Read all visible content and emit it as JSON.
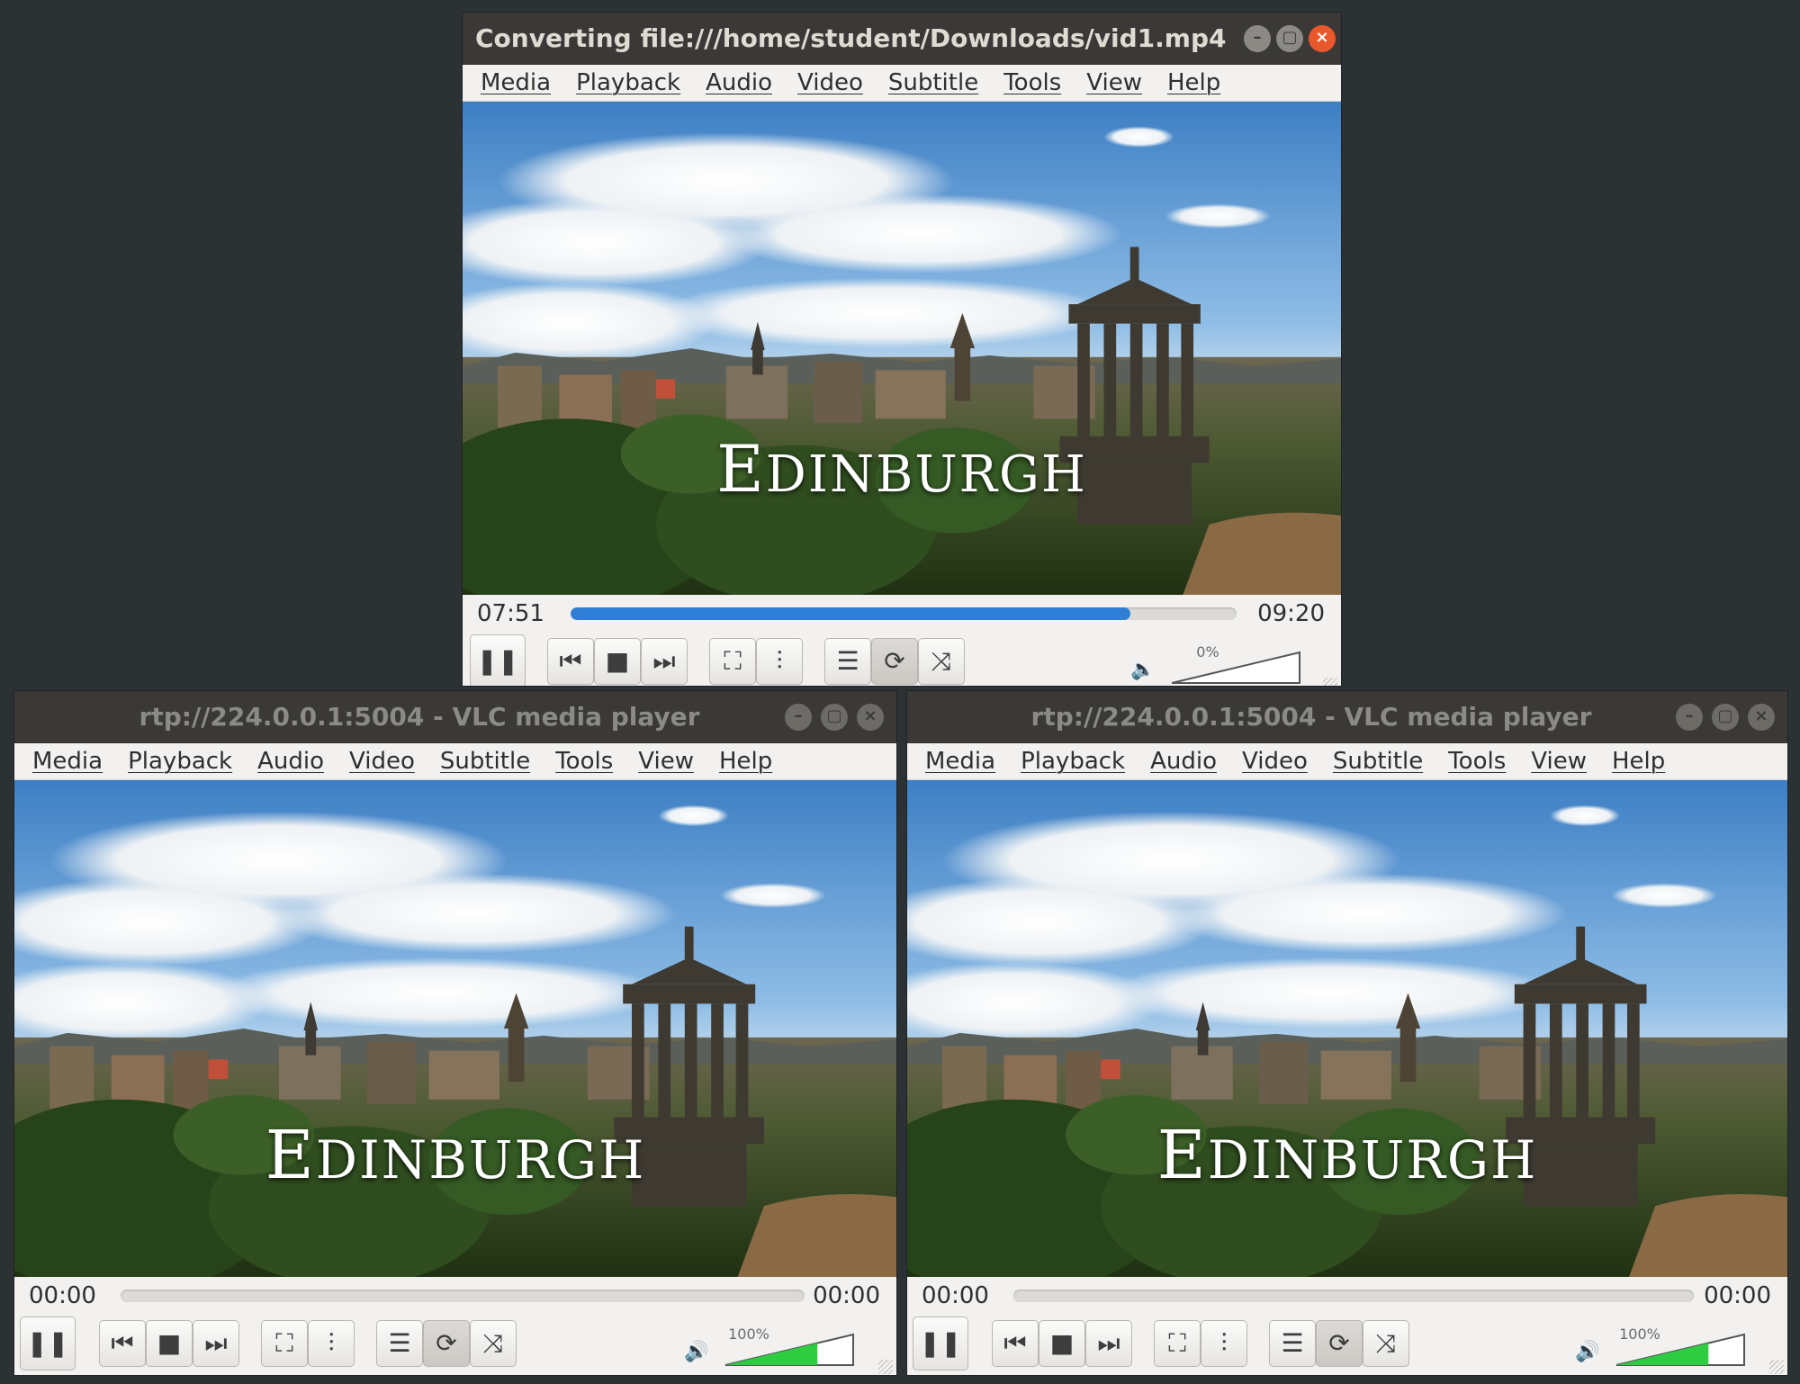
{
  "colors": {
    "desktop": "#2c3133",
    "progress": "#2f7fd6",
    "volume_fill": "#2ecc40",
    "close_active": "#e9582b",
    "volume_icon": "#f08a24"
  },
  "windows": {
    "top": {
      "title": "Converting file:///home/student/Downloads/vid1.mp4 - ...",
      "menu": [
        "Media",
        "Playback",
        "Audio",
        "Video",
        "Subtitle",
        "Tools",
        "View",
        "Help"
      ],
      "caption_initial": "E",
      "caption_rest": "DINBURGH",
      "time_elapsed": "07:51",
      "time_total": "09:20",
      "progress": 0.84,
      "volume_label": "0%",
      "volume_level": 0
    },
    "left": {
      "title": "rtp://224.0.0.1:5004 - VLC media player",
      "menu": [
        "Media",
        "Playback",
        "Audio",
        "Video",
        "Subtitle",
        "Tools",
        "View",
        "Help"
      ],
      "caption_initial": "E",
      "caption_rest": "DINBURGH",
      "time_elapsed": "00:00",
      "time_total": "00:00",
      "progress": 0,
      "volume_label": "100%",
      "volume_level": 1.0
    },
    "right": {
      "title": "rtp://224.0.0.1:5004 - VLC media player",
      "menu": [
        "Media",
        "Playback",
        "Audio",
        "Video",
        "Subtitle",
        "Tools",
        "View",
        "Help"
      ],
      "caption_initial": "E",
      "caption_rest": "DINBURGH",
      "time_elapsed": "00:00",
      "time_total": "00:00",
      "progress": 0,
      "volume_label": "100%",
      "volume_level": 1.0
    }
  },
  "icons": {
    "pause": "pause-icon",
    "previous": "skip-previous-icon",
    "stop": "stop-icon",
    "next": "skip-next-icon",
    "fullscreen": "fullscreen-icon",
    "equalizer": "equalizer-icon",
    "playlist": "playlist-icon",
    "loop": "loop-icon",
    "shuffle": "shuffle-icon",
    "volume": "speaker-icon"
  }
}
